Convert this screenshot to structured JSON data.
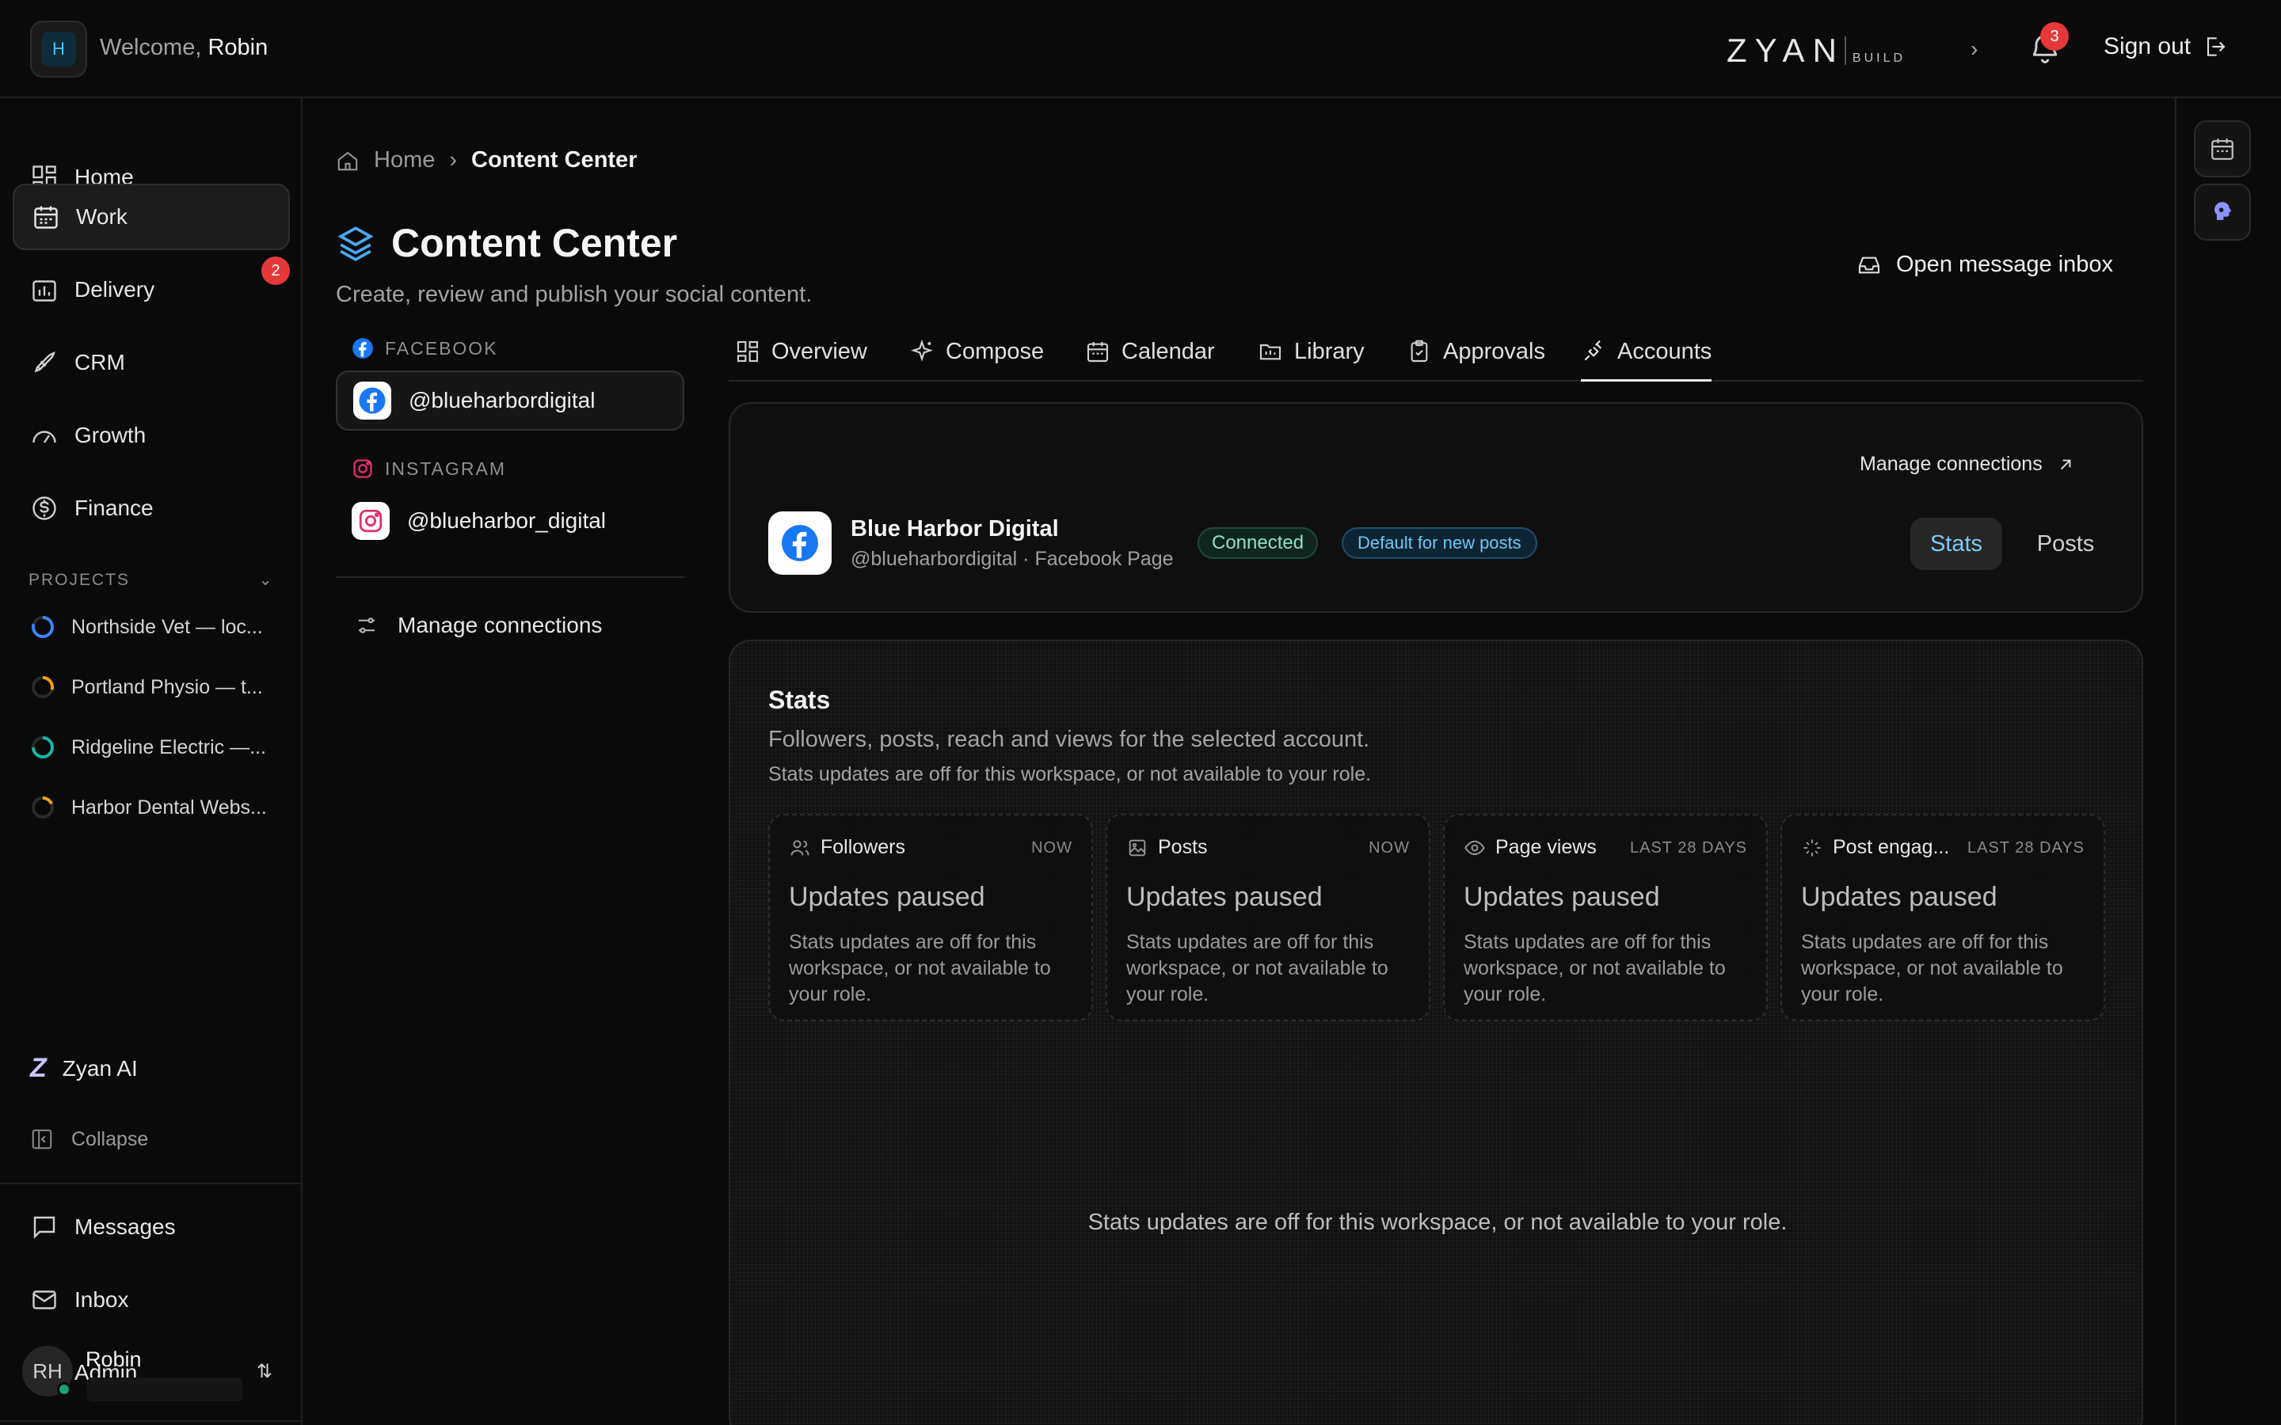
{
  "topbar": {
    "workspace_initial": "H",
    "welcome_prefix": "Welcome,",
    "user_first_name": "Robin",
    "brand": "ZYAN",
    "brand_sub": "BUILD",
    "notifications_count": "3",
    "sign_out_label": "Sign out"
  },
  "sidebar": {
    "items": [
      {
        "label": "Home",
        "icon": "grid-icon"
      },
      {
        "label": "Work",
        "icon": "calendar-icon",
        "active": true
      },
      {
        "label": "Delivery",
        "icon": "chart-icon",
        "badge": "2"
      },
      {
        "label": "CRM",
        "icon": "rocket-icon"
      },
      {
        "label": "Growth",
        "icon": "gauge-icon"
      },
      {
        "label": "Finance",
        "icon": "dollar-icon"
      }
    ],
    "projects_heading": "PROJECTS",
    "projects": [
      {
        "name": "Northside Vet — loc...",
        "color": "#3b82f6"
      },
      {
        "name": "Portland Physio — t...",
        "color": "#f59e0b"
      },
      {
        "name": "Ridgeline Electric —...",
        "color": "#14b8a6"
      },
      {
        "name": "Harbor Dental Webs...",
        "color": "#f59e0b"
      }
    ],
    "zyan_ai_label": "Zyan AI",
    "collapse_label": "Collapse",
    "bottom_items": [
      {
        "label": "Messages",
        "icon": "message-icon"
      },
      {
        "label": "Inbox",
        "icon": "mail-icon"
      },
      {
        "label": "Admin",
        "icon": "gear-icon"
      }
    ],
    "user": {
      "initials": "RH",
      "name": "Robin"
    }
  },
  "breadcrumb": {
    "home": "Home",
    "current": "Content Center"
  },
  "page": {
    "title": "Content Center",
    "subtitle": "Create, review and publish your social content.",
    "open_inbox_label": "Open message inbox"
  },
  "accounts": {
    "facebook_heading": "FACEBOOK",
    "facebook_handle": "@blueharbordigital",
    "instagram_heading": "INSTAGRAM",
    "instagram_handle": "@blueharbor_digital",
    "manage_label": "Manage connections"
  },
  "tabs": [
    {
      "label": "Overview",
      "icon": "grid-icon"
    },
    {
      "label": "Compose",
      "icon": "sparkle-icon"
    },
    {
      "label": "Calendar",
      "icon": "calendar-icon"
    },
    {
      "label": "Library",
      "icon": "folder-icon"
    },
    {
      "label": "Approvals",
      "icon": "clipboard-icon"
    },
    {
      "label": "Accounts",
      "icon": "plug-icon",
      "active": true
    }
  ],
  "account_card": {
    "manage_label": "Manage connections",
    "name": "Blue Harbor Digital",
    "handle": "@blueharbordigital · Facebook Page",
    "status": "Connected",
    "default_badge": "Default for new posts",
    "seg_stats": "Stats",
    "seg_posts": "Posts"
  },
  "stats": {
    "title": "Stats",
    "description": "Followers, posts, reach and views for the selected account.",
    "note": "Stats updates are off for this workspace, or not available to your role.",
    "tiles": [
      {
        "label": "Followers",
        "period": "NOW",
        "value": "Updates paused",
        "desc": "Stats updates are off for this workspace, or not available to your role.",
        "icon": "users-icon"
      },
      {
        "label": "Posts",
        "period": "NOW",
        "value": "Updates paused",
        "desc": "Stats updates are off for this workspace, or not available to your role.",
        "icon": "image-icon"
      },
      {
        "label": "Page views",
        "period": "LAST 28 DAYS",
        "value": "Updates paused",
        "desc": "Stats updates are off for this workspace, or not available to your role.",
        "icon": "eye-icon"
      },
      {
        "label": "Post engag...",
        "period": "LAST 28 DAYS",
        "value": "Updates paused",
        "desc": "Stats updates are off for this workspace, or not available to your role.",
        "icon": "sparkle-icon"
      }
    ],
    "empty_message": "Stats updates are off for this workspace, or not available to your role."
  },
  "colors": {
    "background": "#0a0a0a",
    "accent_blue": "#7ec9f2",
    "badge_red": "#e5383b",
    "connected_green": "#8fe0c0",
    "facebook_blue": "#1877f2"
  }
}
